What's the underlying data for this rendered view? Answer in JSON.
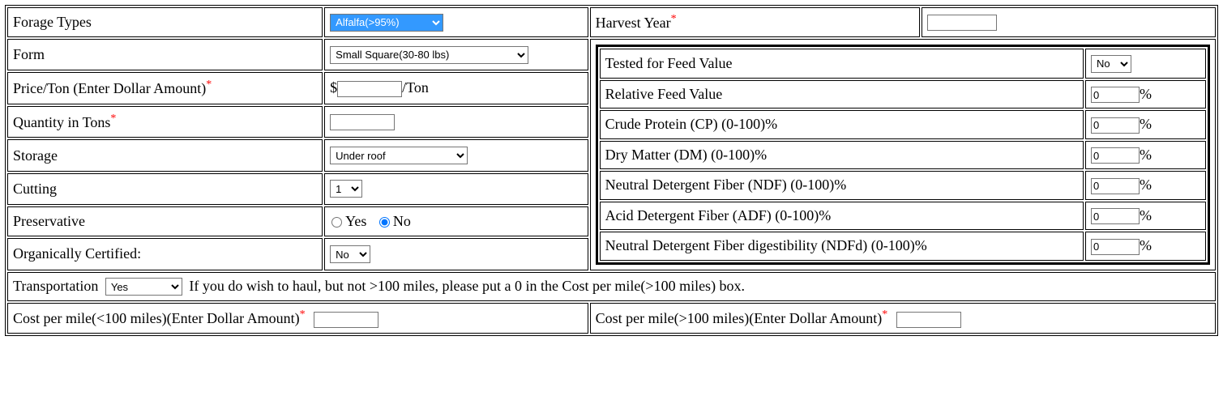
{
  "left": {
    "forage_types": {
      "label": "Forage Types",
      "selected": "Alfalfa(>95%)"
    },
    "form": {
      "label": "Form",
      "selected": "Small Square(30-80 lbs)"
    },
    "price": {
      "label": "Price/Ton (Enter Dollar Amount)",
      "prefix": "$",
      "suffix": "/Ton",
      "value": ""
    },
    "quantity": {
      "label": "Quantity in Tons",
      "value": ""
    },
    "storage": {
      "label": "Storage",
      "selected": "Under roof"
    },
    "cutting": {
      "label": "Cutting",
      "selected": "1"
    },
    "preservative": {
      "label": "Preservative",
      "yes_label": "Yes",
      "no_label": "No",
      "value": "No"
    },
    "organic": {
      "label": "Organically Certified:",
      "selected": "No"
    }
  },
  "right": {
    "harvest_year": {
      "label": "Harvest Year",
      "value": ""
    },
    "feed": {
      "tested": {
        "label": "Tested for Feed Value",
        "selected": "No"
      },
      "rfv": {
        "label": "Relative Feed Value",
        "value": "0",
        "suffix": "%"
      },
      "cp": {
        "label": "Crude Protein (CP) (0-100)%",
        "value": "0",
        "suffix": "%"
      },
      "dm": {
        "label": "Dry Matter (DM) (0-100)%",
        "value": "0",
        "suffix": "%"
      },
      "ndf": {
        "label": "Neutral Detergent Fiber (NDF) (0-100)%",
        "value": "0",
        "suffix": "%"
      },
      "adf": {
        "label": "Acid Detergent Fiber (ADF) (0-100)%",
        "value": "0",
        "suffix": "%"
      },
      "ndfd": {
        "label": "Neutral Detergent Fiber digestibility (NDFd) (0-100)%",
        "value": "0",
        "suffix": "%"
      }
    }
  },
  "transport": {
    "label": "Transportation",
    "selected": "Yes",
    "note": "If you do wish to haul, but not >100 miles, please put a 0 in the Cost per mile(>100 miles) box.",
    "cost_lt": {
      "label": "Cost per mile(<100 miles)(Enter Dollar Amount)",
      "value": ""
    },
    "cost_gt": {
      "label": "Cost per mile(>100 miles)(Enter Dollar Amount)",
      "value": ""
    }
  }
}
